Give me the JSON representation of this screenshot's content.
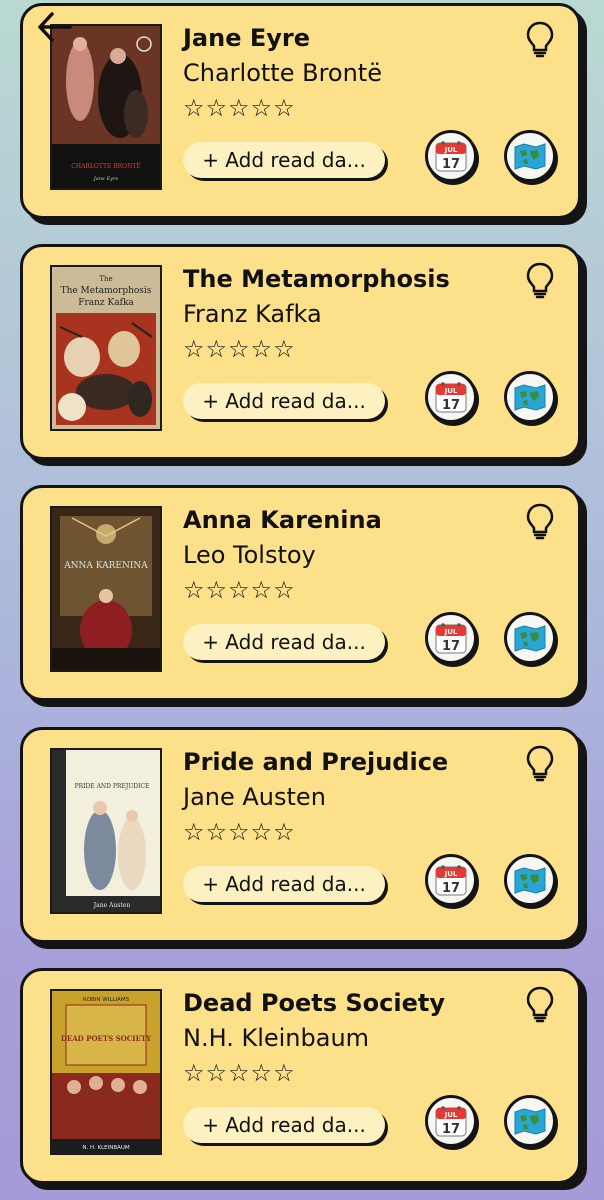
{
  "nav": {
    "back_icon": "arrow-left-icon"
  },
  "books": [
    {
      "title": "Jane Eyre",
      "author": "Charlotte Brontë",
      "rating": 0,
      "max_rating": 5,
      "cover": {
        "bg": "#5a2a1c",
        "author_text": "CHARLOTTE BRONTË",
        "title_text": "Jane Eyre"
      },
      "add_label": "+ Add read da..."
    },
    {
      "title": "The Metamorphosis",
      "author": "Franz Kafka",
      "rating": 0,
      "max_rating": 5,
      "cover": {
        "bg": "#c9b89a",
        "author_text": "Franz Kafka",
        "title_text": "The Metamorphosis"
      },
      "add_label": "+ Add read da..."
    },
    {
      "title": "Anna Karenina",
      "author": "Leo Tolstoy",
      "rating": 0,
      "max_rating": 5,
      "cover": {
        "bg": "#3e2a1a",
        "author_text": "",
        "title_text": "ANNA KARENINA"
      },
      "add_label": "+ Add read da..."
    },
    {
      "title": "Pride and Prejudice",
      "author": "Jane Austen",
      "rating": 0,
      "max_rating": 5,
      "cover": {
        "bg": "#f2eedc",
        "author_text": "Jane Austen",
        "title_text": "PRIDE AND PREJUDICE"
      },
      "add_label": "+ Add read da..."
    },
    {
      "title": "Dead Poets Society",
      "author": "N.H. Kleinbaum",
      "rating": 0,
      "max_rating": 5,
      "cover": {
        "bg": "#c8a12a",
        "author_text": "N. H. KLEINBAUM",
        "title_text": "DEAD POETS SOCIETY",
        "top_text": "ROBIN WILLIAMS"
      },
      "add_label": "+ Add read da..."
    }
  ],
  "icons": {
    "idea": "lightbulb-icon",
    "calendar": "calendar-icon",
    "calendar_month": "JUL",
    "calendar_day": "17",
    "map": "map-icon"
  },
  "colors": {
    "card": "#fde08a",
    "button": "#fdf1c2",
    "outline": "#141414"
  }
}
